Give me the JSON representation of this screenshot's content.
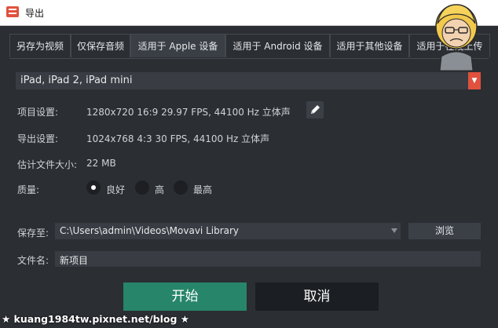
{
  "window": {
    "title": "导出"
  },
  "tabs": [
    {
      "label": "另存为视频",
      "active": false
    },
    {
      "label": "仅保存音频",
      "active": false
    },
    {
      "label": "适用于 Apple 设备",
      "active": true
    },
    {
      "label": "适用于 Android 设备",
      "active": false
    },
    {
      "label": "适用于其他设备",
      "active": false
    },
    {
      "label": "适用于在线上传",
      "active": false
    }
  ],
  "preset": {
    "value": "iPad, iPad 2, iPad mini"
  },
  "project_settings": {
    "label": "项目设置:",
    "value": "1280x720 16:9 29.97 FPS, 44100 Hz 立体声"
  },
  "export_settings": {
    "label": "导出设置:",
    "value": "1024x768 4:3 30 FPS, 44100 Hz 立体声"
  },
  "estimated_size": {
    "label": "估计文件大小:",
    "value": "22 MB"
  },
  "quality": {
    "label": "质量:",
    "options": [
      {
        "label": "良好",
        "selected": true
      },
      {
        "label": "高",
        "selected": false
      },
      {
        "label": "最高",
        "selected": false
      }
    ]
  },
  "save_to": {
    "label": "保存至:",
    "value": "C:\\Users\\admin\\Videos\\Movavi Library",
    "browse_label": "浏览"
  },
  "file_name": {
    "label": "文件名:",
    "value": "新项目"
  },
  "buttons": {
    "start": "开始",
    "cancel": "取消"
  },
  "watermark": "★ kuang1984tw.pixnet.net/blog ★",
  "colors": {
    "accent": "#e0513e",
    "start": "#27856a",
    "background": "#2b2e33"
  },
  "icons": {
    "edit": "pencil-icon",
    "dropdown": "chevron-down-icon"
  }
}
